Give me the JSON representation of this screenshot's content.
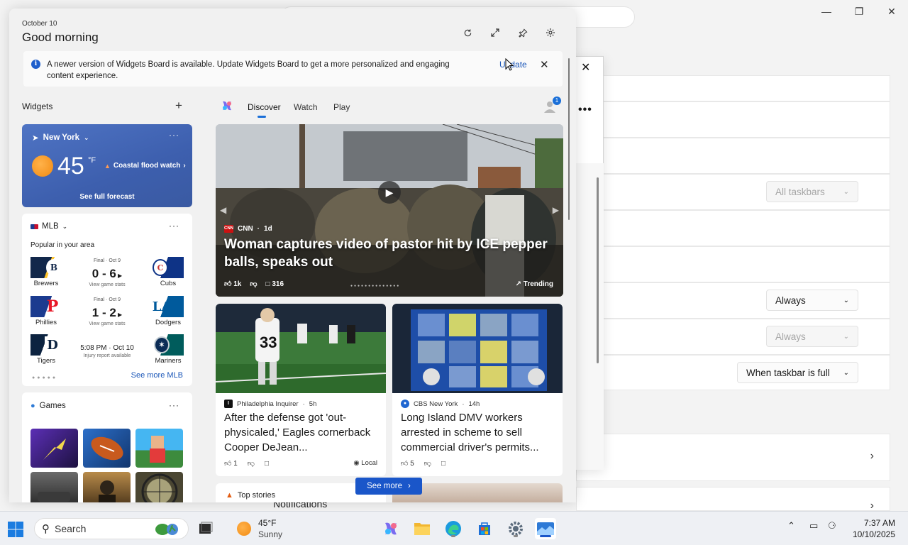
{
  "settings": {
    "dropdown_all_taskbars": "All taskbars",
    "dropdown_always_1": "Always",
    "dropdown_always_2": "Always",
    "dropdown_when_full": "When taskbar is full",
    "notifications_label": "Notifications"
  },
  "board": {
    "date": "October 10",
    "greeting": "Good morning",
    "header_icons": [
      "refresh-icon",
      "expand-icon",
      "pin-icon",
      "settings-gear-icon"
    ],
    "banner": {
      "message": "A newer version of Widgets Board is available. Update Widgets Board to get a more personalized and engaging content experience.",
      "update_label": "Update"
    },
    "widgets_title": "Widgets",
    "add_label": "+"
  },
  "weather": {
    "location": "New York",
    "temperature": "45",
    "unit": "°F",
    "alert": "Coastal flood watch",
    "forecast_link": "See full forecast"
  },
  "mlb": {
    "title": "MLB",
    "subtitle": "Popular in your area",
    "games": [
      {
        "left": "Brewers",
        "right": "Cubs",
        "status": "Final · Oct 9",
        "score": "0 - 6",
        "stats": "View game stats",
        "left_color": "#12284b",
        "right_color": "#0e3386"
      },
      {
        "left": "Phillies",
        "right": "Dodgers",
        "status": "Final · Oct 9",
        "score": "1 - 2",
        "stats": "View game stats",
        "left_color": "#1b3b8f",
        "right_color": "#005a9c"
      },
      {
        "left": "Tigers",
        "right": "Mariners",
        "time": "5:08 PM · Oct 10",
        "injury": "Injury report available",
        "left_color": "#0c2340",
        "right_color": "#005c5c"
      }
    ],
    "see_more": "See more MLB"
  },
  "games": {
    "title": "Games",
    "tiles": [
      {
        "name": "arrow-game-tile",
        "c1": "#5b2fb5",
        "c2": "#1d1140"
      },
      {
        "name": "football-game-tile",
        "c1": "#2c6fc9",
        "c2": "#12366e"
      },
      {
        "name": "block-game-tile",
        "c1": "#45b6f2",
        "c2": "#3d8b3d"
      },
      {
        "name": "racing-game-tile",
        "c1": "#6b6b6b",
        "c2": "#1f1f1f"
      },
      {
        "name": "hazmob-game-tile",
        "c1": "#b88b4a",
        "c2": "#3d2a14"
      },
      {
        "name": "hunting-game-tile",
        "c1": "#a8a27a",
        "c2": "#4a4632"
      }
    ]
  },
  "feed": {
    "tabs": [
      "Discover",
      "Watch",
      "Play"
    ],
    "notification_badge": "1",
    "hero": {
      "source": "CNN",
      "age": "1d",
      "title": "Woman captures video of pastor hit by ICE pepper balls, speaks out",
      "likes": "1k",
      "comments": "316",
      "trending": "Trending"
    },
    "cards": [
      {
        "source": "Philadelphia Inquirer",
        "age": "5h",
        "title": "After the defense got 'out-physicaled,' Eagles cornerback Cooper DeJean...",
        "likes": "1",
        "local": "Local",
        "icon_color": "#111111",
        "icon_letter": "I"
      },
      {
        "source": "CBS New York",
        "age": "14h",
        "title": "Long Island DMV workers arrested in scheme to sell commercial driver's permits...",
        "likes": "5",
        "icon_color": "#1f66d1",
        "icon_letter": "●"
      }
    ],
    "top_stories": "Top stories",
    "see_more": "See more"
  },
  "taskbar": {
    "search_placeholder": "Search",
    "weather_temp": "45°F",
    "weather_cond": "Sunny",
    "time": "7:37 AM",
    "date": "10/10/2025"
  }
}
